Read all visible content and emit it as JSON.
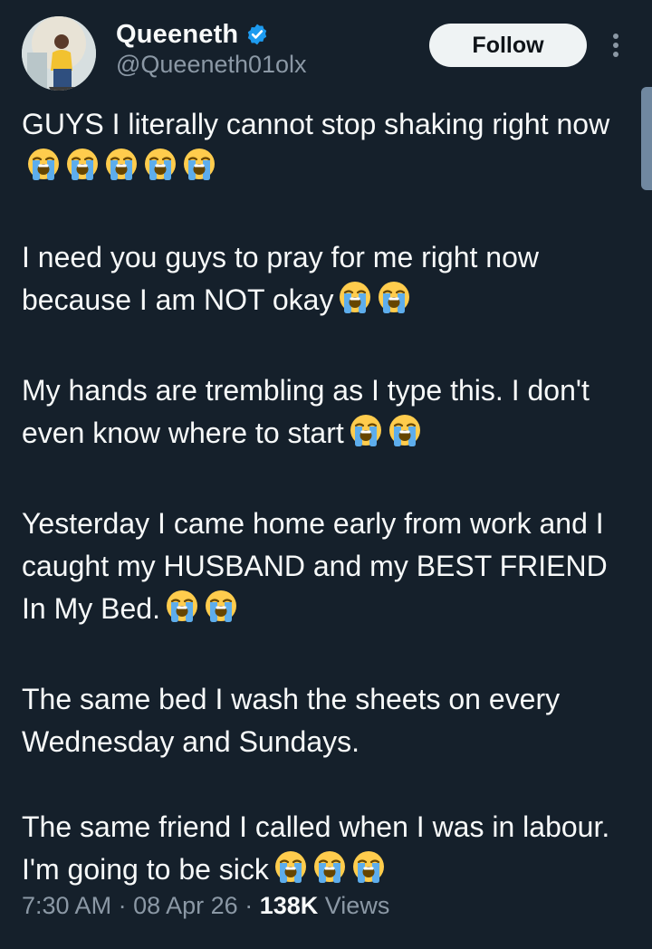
{
  "author": {
    "display_name": "Queeneth",
    "handle": "@Queeneth01olx",
    "verified": true
  },
  "actions": {
    "follow_label": "Follow"
  },
  "tweet": {
    "paragraphs": [
      {
        "text": "GUYS I literally cannot stop shaking right now",
        "emoji_count": 5
      },
      {
        "text": "I need you guys to pray for me right now because I am NOT okay",
        "emoji_count": 2
      },
      {
        "text": "My hands are trembling as I type this. I don't even know where to start",
        "emoji_count": 2
      },
      {
        "text": "Yesterday I came home early from work and I caught my HUSBAND and my BEST FRIEND In My Bed.",
        "emoji_count": 2
      },
      {
        "text": "The same bed I wash the sheets on every Wednesday and Sundays.",
        "emoji_count": 0
      },
      {
        "text": "The same friend I called when I was in labour. I'm going to be sick",
        "emoji_count": 3
      }
    ],
    "emoji_icon": "loudly-crying-face-icon"
  },
  "meta": {
    "time": "7:30 AM",
    "date": "08 Apr 26",
    "separator": "·",
    "views_count": "138K",
    "views_label": "Views"
  },
  "colors": {
    "background": "#15202b",
    "text_primary": "#f7f9f9",
    "text_secondary": "#8b98a5",
    "verified_badge": "#1d9bf0",
    "follow_button_bg": "#eff3f4",
    "emoji_face": "#ffcc4d",
    "emoji_tears": "#5dadec"
  }
}
